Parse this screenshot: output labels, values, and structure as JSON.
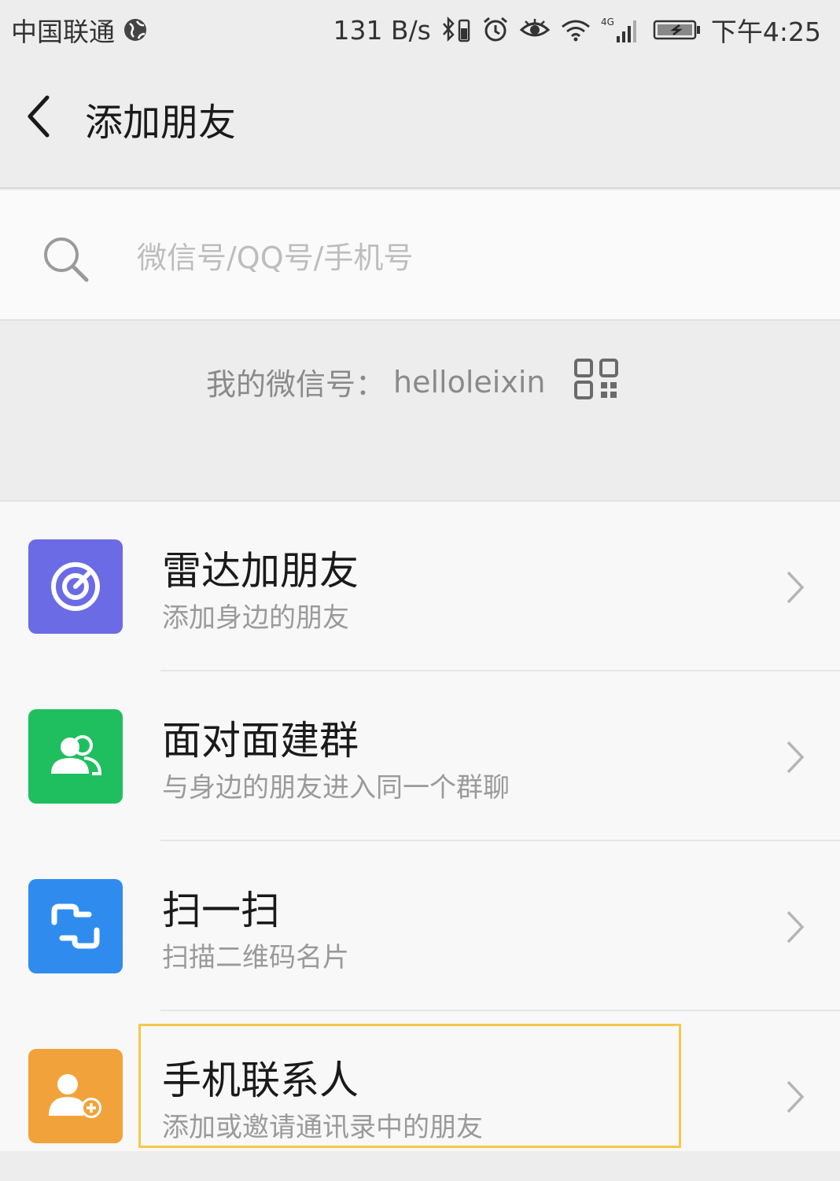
{
  "status_bar": {
    "carrier": "中国联通",
    "net_speed": "131 B/s",
    "network_type": "4G",
    "time": "下午4:25"
  },
  "nav": {
    "title": "添加朋友"
  },
  "search": {
    "placeholder": "微信号/QQ号/手机号",
    "value": ""
  },
  "my_id": {
    "label": "我的微信号：",
    "value": "helloleixin"
  },
  "items": [
    {
      "title": "雷达加朋友",
      "subtitle": "添加身边的朋友",
      "icon": "radar-icon",
      "color": "#6b6be6"
    },
    {
      "title": "面对面建群",
      "subtitle": "与身边的朋友进入同一个群聊",
      "icon": "group-people-icon",
      "color": "#1fbf5f"
    },
    {
      "title": "扫一扫",
      "subtitle": "扫描二维码名片",
      "icon": "scan-icon",
      "color": "#2f8cee"
    },
    {
      "title": "手机联系人",
      "subtitle": "添加或邀请通讯录中的朋友",
      "icon": "add-contact-icon",
      "color": "#f2a23a"
    }
  ],
  "colors": {
    "highlight": "#f4c94a",
    "background": "#ededed"
  }
}
